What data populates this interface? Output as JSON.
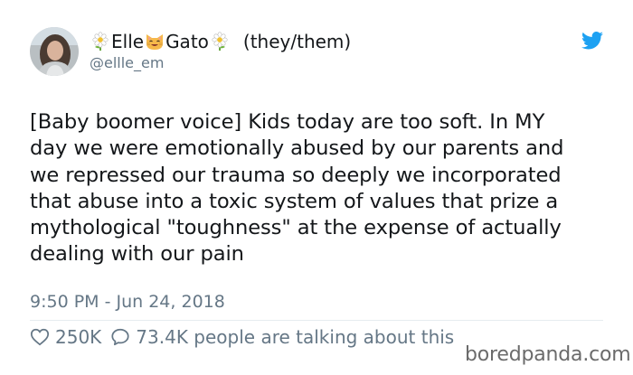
{
  "tweet": {
    "display_name_part1": "Elle",
    "display_name_part2": "Gato",
    "pronouns": "(they/them)",
    "handle": "@ellle_em",
    "text": "[Baby boomer voice] Kids today are too soft. In MY\nday we were emotionally abused by our parents and\nwe repressed our trauma so deeply we incorporated\nthat abuse into a toxic system of values that prize a\nmythological \"toughness\" at the expense of actually\ndealing with our pain",
    "timestamp": "9:50 PM - Jun 24, 2018",
    "likes": "250K",
    "replies_summary": "73.4K people are talking about this"
  },
  "watermark": "boredpanda.com",
  "icons": {
    "flower": "daisy-flower-icon",
    "cat": "cat-face-icon",
    "brand": "twitter-bird-icon",
    "like": "heart-icon",
    "reply": "speech-bubble-icon"
  },
  "colors": {
    "text": "#14171a",
    "muted": "#657786",
    "twitter_blue": "#1da1f2"
  }
}
